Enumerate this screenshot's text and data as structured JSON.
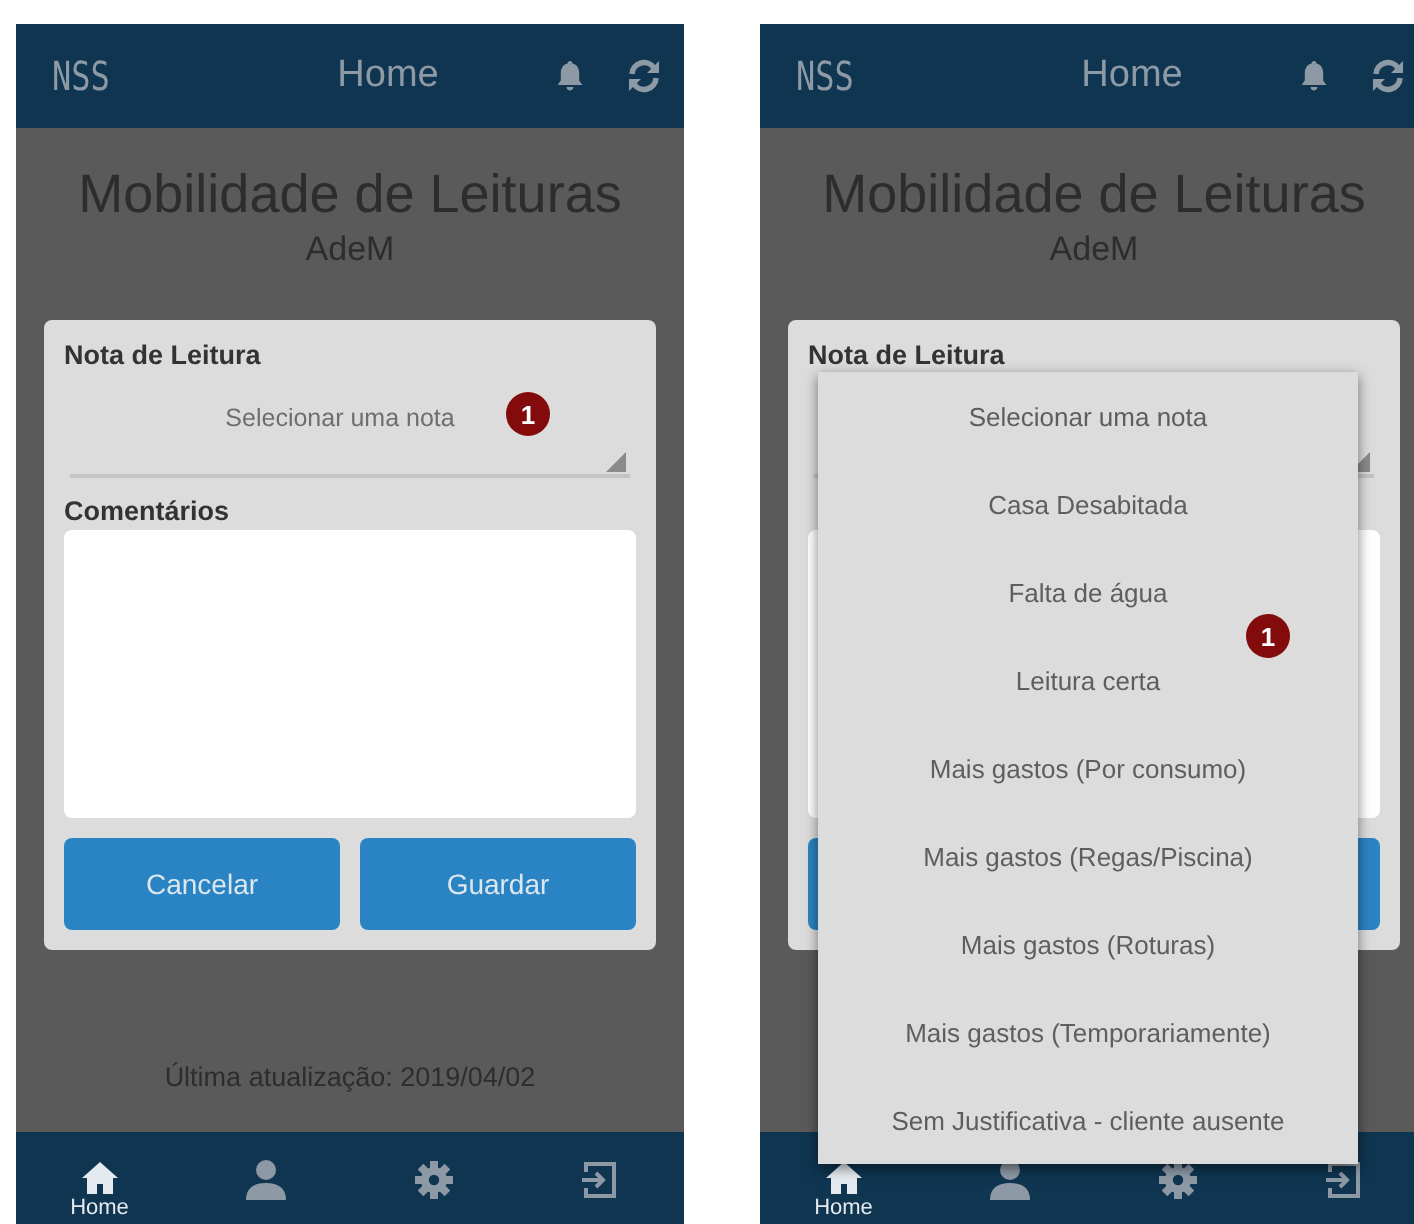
{
  "screens": [
    {
      "header": {
        "logo": "NSS",
        "title": "Home"
      },
      "heading": "Mobilidade de Leituras",
      "subheading": "AdeM",
      "card": {
        "note_label": "Nota de Leitura",
        "select": {
          "placeholder": "Selecionar uma nota",
          "badge": "1"
        },
        "comments_label": "Comentários",
        "buttons": [
          {
            "kind": "button",
            "label": "Cancelar"
          },
          {
            "kind": "button",
            "label": "Guardar"
          }
        ]
      },
      "last_update": "Última atualização: 2019/04/02",
      "nav": [
        {
          "kind": "home",
          "label": "Home",
          "selected": true
        },
        {
          "kind": "user",
          "selected": false
        },
        {
          "kind": "settings",
          "selected": false
        },
        {
          "kind": "logout",
          "selected": false
        }
      ]
    },
    {
      "header": {
        "logo": "NSS",
        "title": "Home"
      },
      "heading": "Mobilidade de Leituras",
      "subheading": "AdeM",
      "card": {
        "note_label": "Nota de Leitura",
        "buttons": [
          {
            "kind": "button"
          },
          {
            "kind": "button"
          }
        ]
      },
      "nav": [
        {
          "kind": "home",
          "label": "Home",
          "selected": true
        },
        {
          "kind": "user",
          "selected": false
        },
        {
          "kind": "settings",
          "selected": false
        },
        {
          "kind": "logout",
          "selected": false
        }
      ],
      "dropdown": {
        "badge": "1",
        "options": [
          "Selecionar uma nota",
          "Casa Desabitada",
          "Falta de água",
          "Leitura certa",
          "Mais gastos (Por consumo)",
          "Mais gastos (Regas/Piscina)",
          "Mais gastos (Roturas)",
          "Mais gastos (Temporariamente)",
          "Sem Justificativa - cliente ausente"
        ]
      }
    }
  ]
}
